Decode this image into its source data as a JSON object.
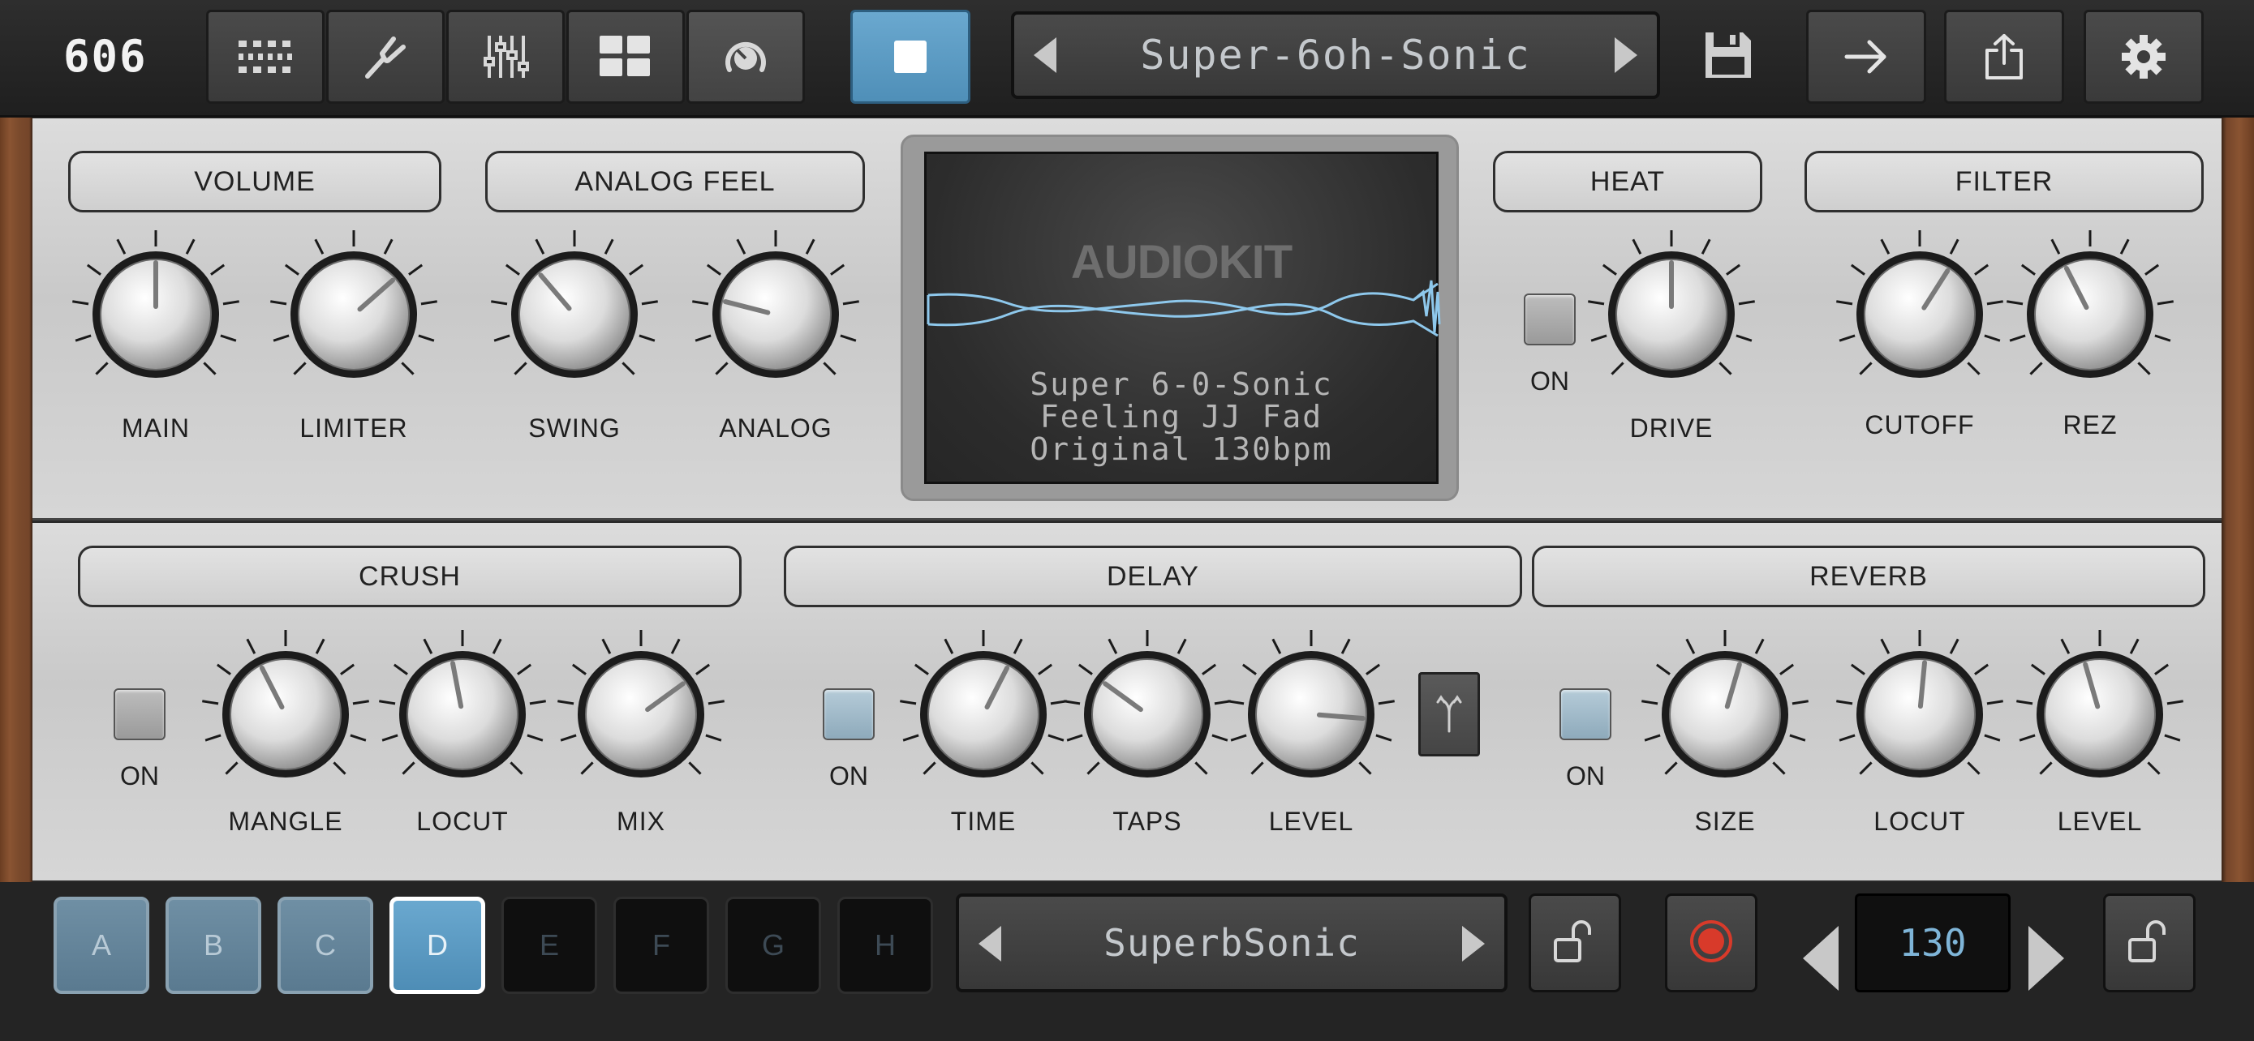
{
  "app": {
    "logo": "606"
  },
  "toolbar": {
    "buttons": [
      {
        "icon": "sequencer-grid-icon"
      },
      {
        "icon": "tuning-fork-icon"
      },
      {
        "icon": "mixer-sliders-icon"
      },
      {
        "icon": "pads-grid-icon"
      },
      {
        "icon": "fx-knob-icon"
      }
    ],
    "stop_icon": "stop-icon",
    "preset_name": "Super-6oh-Sonic",
    "right_icons": [
      "save-icon",
      "arrow-right-icon",
      "share-icon",
      "gear-icon"
    ]
  },
  "fx_top": {
    "volume": {
      "title": "VOLUME",
      "knobs": [
        {
          "label": "MAIN",
          "value": 0.5
        },
        {
          "label": "LIMITER",
          "value": 0.68
        }
      ]
    },
    "analog_feel": {
      "title": "ANALOG FEEL",
      "knobs": [
        {
          "label": "SWING",
          "value": 0.35
        },
        {
          "label": "ANALOG",
          "value": 0.22
        }
      ]
    },
    "heat": {
      "title": "HEAT",
      "on_label": "ON",
      "on": false,
      "knobs": [
        {
          "label": "DRIVE",
          "value": 0.5
        }
      ]
    },
    "filter": {
      "title": "FILTER",
      "knobs": [
        {
          "label": "CUTOFF",
          "value": 0.62
        },
        {
          "label": "REZ",
          "value": 0.4
        }
      ]
    }
  },
  "display": {
    "logo": "AUDIOKIT",
    "lines": [
      "Super 6-0-Sonic",
      "Feeling JJ Fad",
      "Original 130bpm"
    ],
    "wave_color": "#8ec8ec"
  },
  "fx_bottom": {
    "crush": {
      "title": "CRUSH",
      "on_label": "ON",
      "on": false,
      "knobs": [
        {
          "label": "MANGLE",
          "value": 0.4
        },
        {
          "label": "LOCUT",
          "value": 0.46
        },
        {
          "label": "MIX",
          "value": 0.7
        }
      ]
    },
    "delay": {
      "title": "DELAY",
      "on_label": "ON",
      "on": true,
      "knobs": [
        {
          "label": "TIME",
          "value": 0.6
        },
        {
          "label": "TAPS",
          "value": 0.3
        },
        {
          "label": "LEVEL",
          "value": 0.85
        }
      ],
      "fork_icon": "fork-icon"
    },
    "reverb": {
      "title": "REVERB",
      "on_label": "ON",
      "on": true,
      "knobs": [
        {
          "label": "SIZE",
          "value": 0.56
        },
        {
          "label": "LOCUT",
          "value": 0.52
        },
        {
          "label": "LEVEL",
          "value": 0.44
        }
      ]
    }
  },
  "bottom": {
    "patterns": [
      {
        "label": "A",
        "state": "on"
      },
      {
        "label": "B",
        "state": "on"
      },
      {
        "label": "C",
        "state": "on"
      },
      {
        "label": "D",
        "state": "sel"
      },
      {
        "label": "E",
        "state": "off"
      },
      {
        "label": "F",
        "state": "off"
      },
      {
        "label": "G",
        "state": "off"
      },
      {
        "label": "H",
        "state": "off"
      }
    ],
    "sequence_name": "SuperbSonic",
    "bpm": "130",
    "record_color": "#d83a2a"
  }
}
